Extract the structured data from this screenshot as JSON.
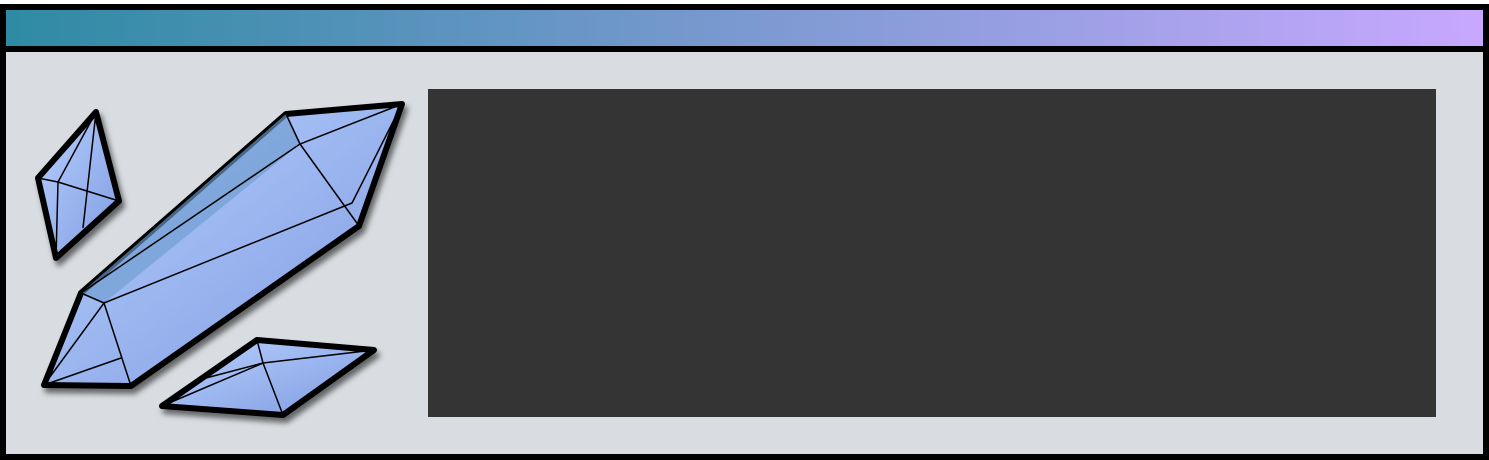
{
  "window": {
    "title": "",
    "titlebar_gradient": [
      "#2e8ba3",
      "#c8a8ff"
    ],
    "background_color": "#d9dde1",
    "border_color": "#000000"
  },
  "icon": {
    "name": "crystal-icon",
    "fill_color": "#9ab8f2"
  },
  "display_panel": {
    "text": "",
    "background_color": "#343434"
  }
}
